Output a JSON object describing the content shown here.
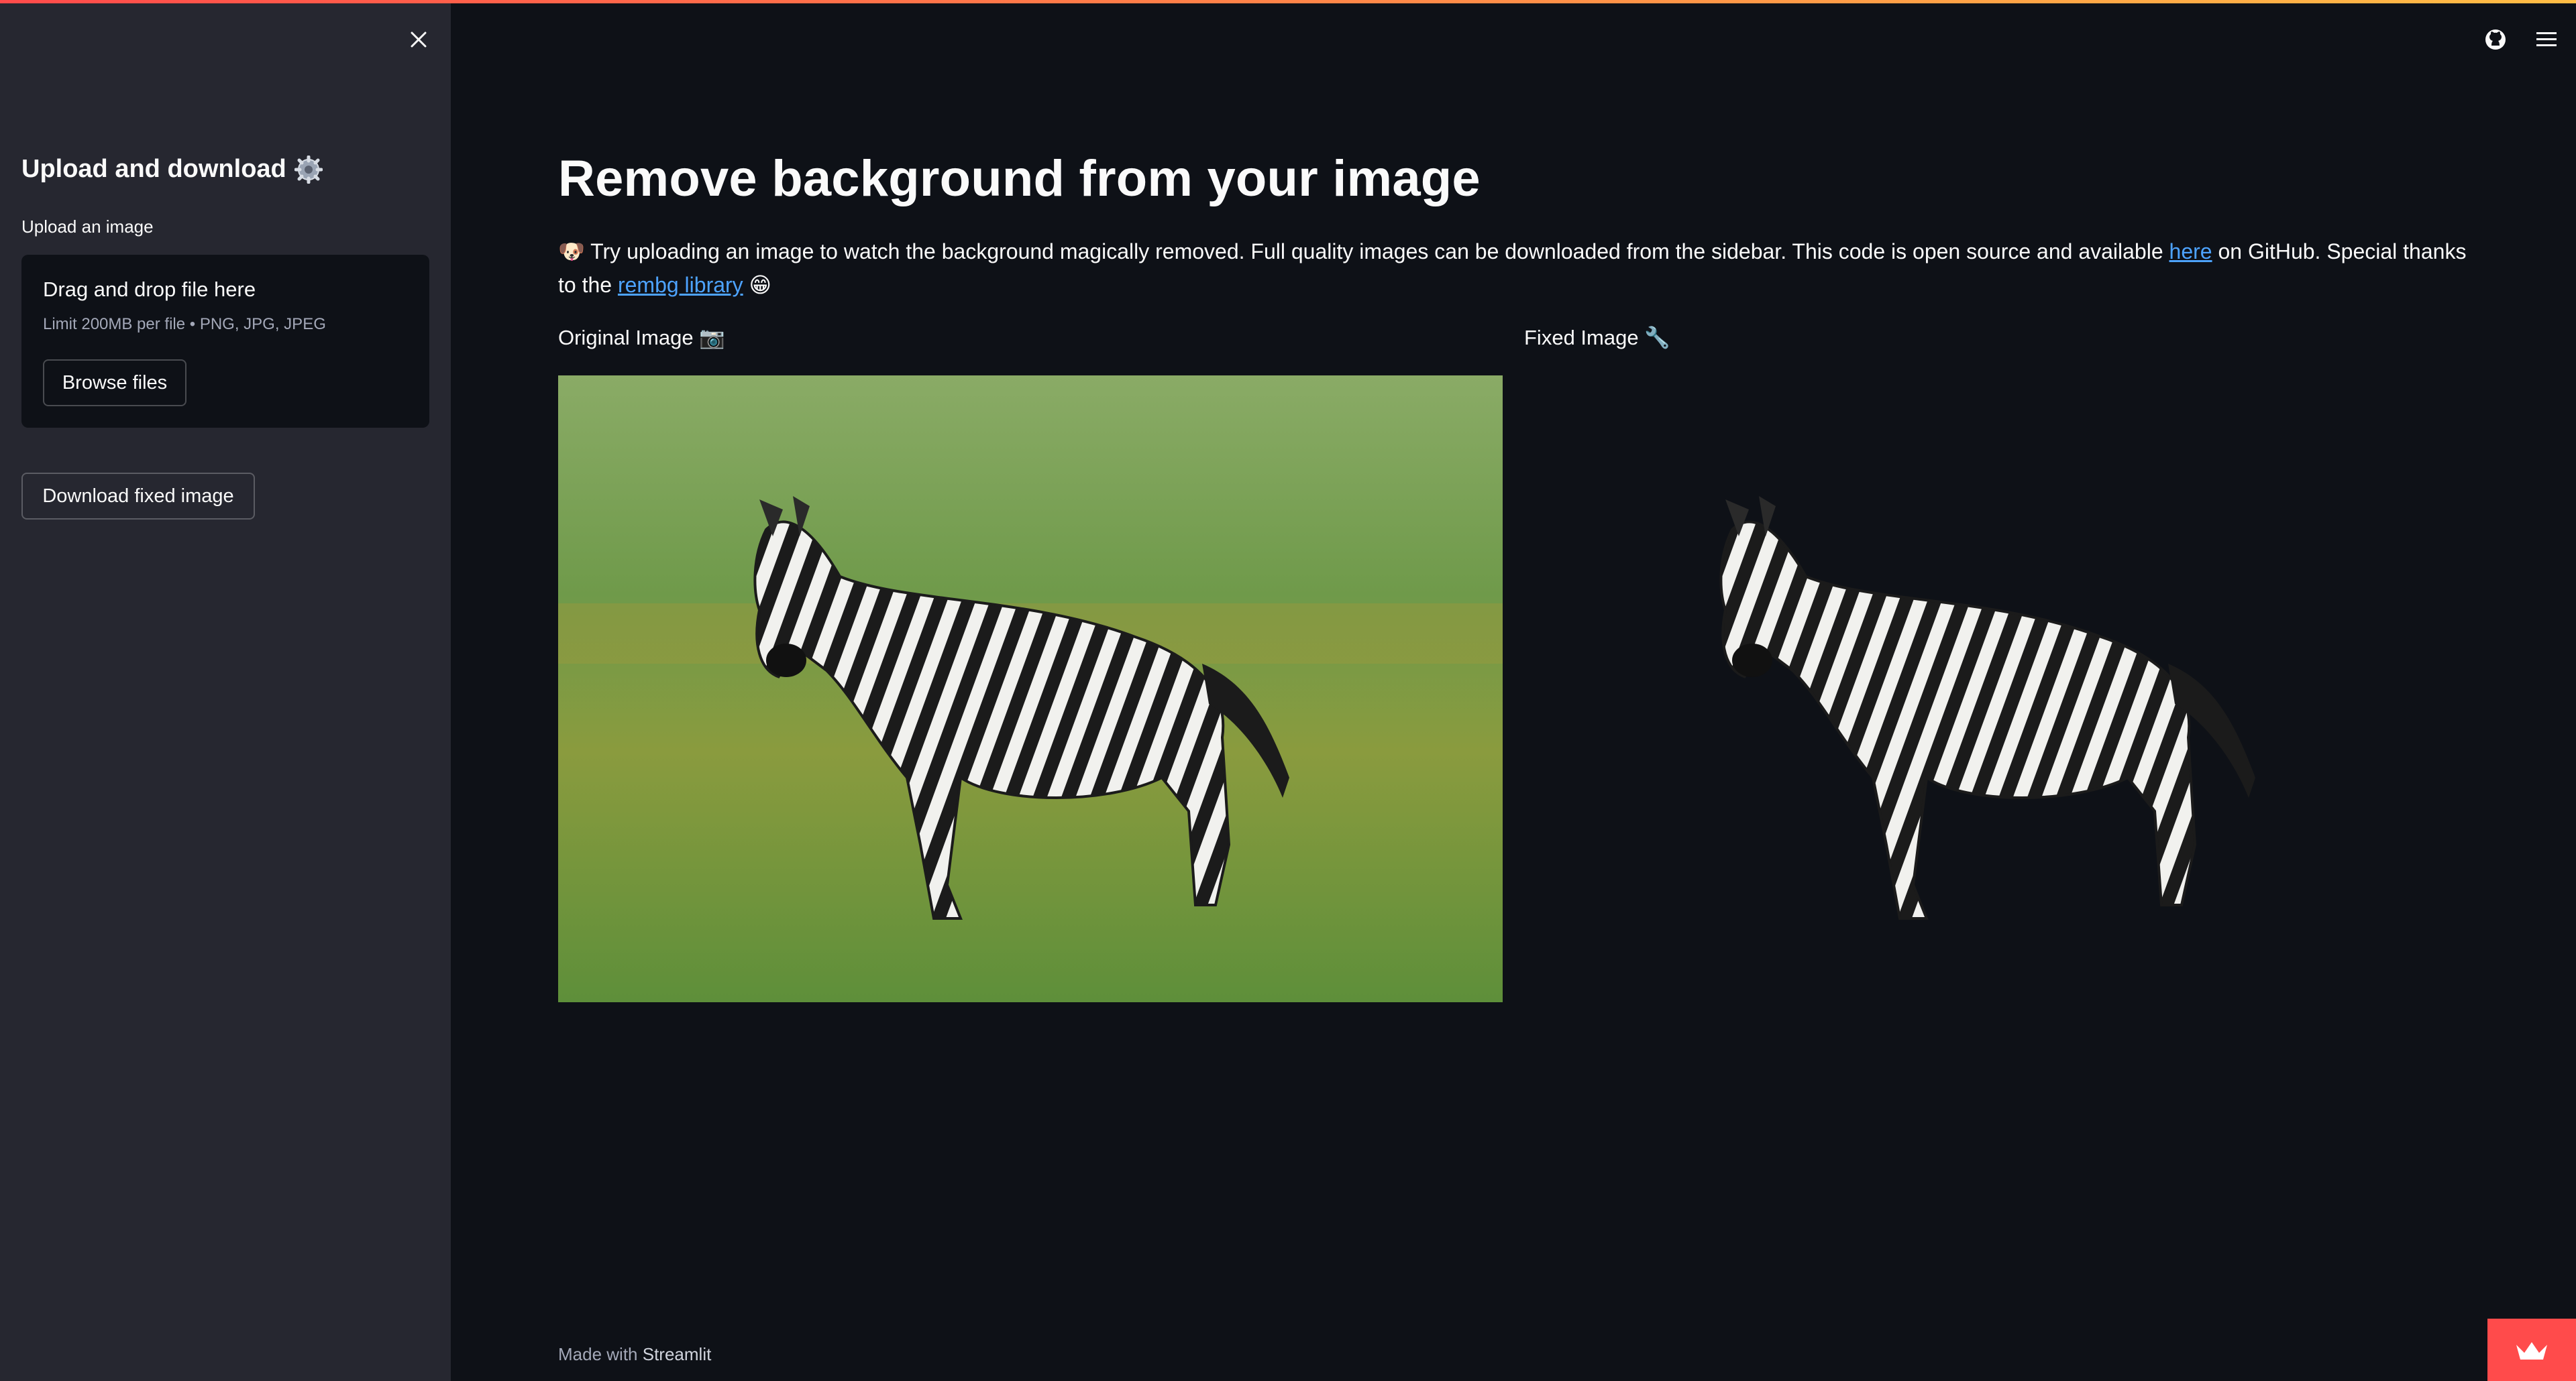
{
  "sidebar": {
    "title": "Upload and download",
    "title_icon": "gear-icon",
    "upload_label": "Upload an image",
    "dropzone": {
      "title": "Drag and drop file here",
      "limit": "Limit 200MB per file • PNG, JPG, JPEG",
      "browse_label": "Browse files"
    },
    "download_label": "Download fixed image"
  },
  "header": {
    "icons": [
      "github-icon",
      "hamburger-menu-icon"
    ]
  },
  "main": {
    "title": "Remove background from your image",
    "description": {
      "lead_emoji": "🐶",
      "text_1": "Try uploading an image to watch the background magically removed. Full quality images can be downloaded from the sidebar. This code is open source and available ",
      "link_here": "here",
      "text_2": " on GitHub. Special thanks to the ",
      "link_rembg": "rembg library",
      "trail_emoji": "😁"
    },
    "original_label": "Original Image 📷",
    "fixed_label": "Fixed Image 🔧"
  },
  "footer": {
    "prefix": "Made with ",
    "brand": "Streamlit"
  },
  "colors": {
    "background": "#0e1117",
    "sidebar": "#262730",
    "link": "#4da3ff",
    "accent": "#ff4b4b"
  }
}
